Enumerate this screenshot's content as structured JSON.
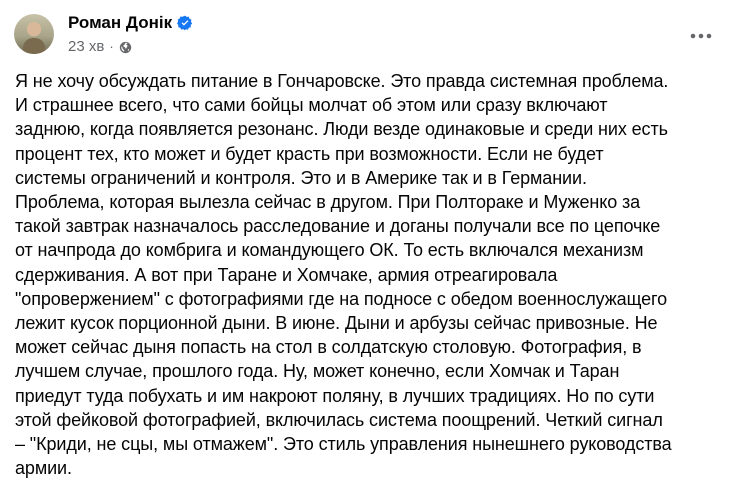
{
  "post": {
    "author": "Роман Донік",
    "time": "23 хв",
    "separator": "·",
    "text": "Я не хочу обсуждать питание в Гончаровске. Это правда системная проблема.\nИ страшнее всего, что сами бойцы молчат об этом или сразу включают\nзаднюю, когда появляется резонанс.  Люди везде одинаковые и среди них есть\nпроцент тех, кто может и будет красть при возможности. Если не будет\nсистемы ограничений и контроля. Это и в Америке так и в Германии.\nПроблема, которая вылезла сейчас в другом. При Полтораке и Муженко за\nтакой завтрак назначалось расследование и доганы получали все по цепочке\nот начпрода до комбрига и командующего ОК. То есть включался механизм\nсдерживания. А вот при Таране и Хомчаке, армия отреагировала\n\"опровержением\" с фотографиями где на подносе с обедом военнослужащего\nлежит кусок порционной дыни. В июне. Дыни и арбузы сейчас привозные. Не\nможет сейчас дыня попасть на стол в солдатскую столовую. Фотография, в\nлучшем случае, прошлого года. Ну, может конечно, если Хомчак и Таран\nприедут туда побухать и им накроют поляну, в лучших традициях. Но по сути\nэтой фейковой фотографией, включилась система поощрений. Четкий сигнал\n– \"Криди, не сцы, мы отмажем\". Это стиль управления нынешнего руководства\nармии."
  },
  "icons": {
    "verified": "verified-badge-icon",
    "privacy": "globe-icon",
    "menu": "more-options-icon"
  },
  "colors": {
    "verified": "#1877f2",
    "secondary_text": "#65676b",
    "primary_text": "#050505"
  }
}
